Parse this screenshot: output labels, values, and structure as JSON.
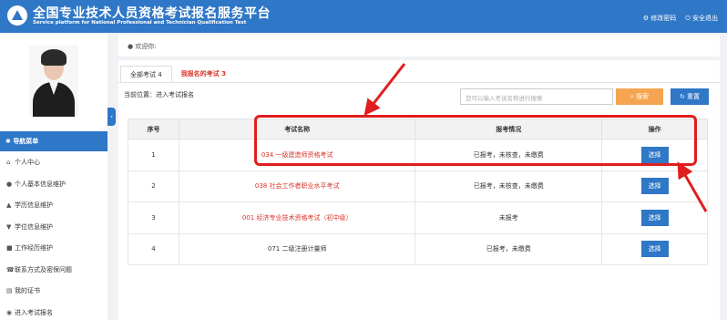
{
  "header": {
    "title": "全国专业技术人员资格考试报名服务平台",
    "subtitle": "Service platform for National Professional and Technician Qualification Test",
    "change_password": "修改密码",
    "logout": "安全退出"
  },
  "user": {
    "welcome": "欢迎你:"
  },
  "sidebar": {
    "nav_head": "导航菜单",
    "items": [
      {
        "label": "个人中心",
        "icon": "home-icon"
      },
      {
        "label": "个人基本信息维护",
        "icon": "user-icon"
      },
      {
        "label": "学历信息维护",
        "icon": "graduation-cap-icon"
      },
      {
        "label": "学位信息维护",
        "icon": "degree-icon"
      },
      {
        "label": "工作经历维护",
        "icon": "briefcase-icon"
      },
      {
        "label": "联系方式及密保问题",
        "icon": "phone-icon"
      },
      {
        "label": "我的证书",
        "icon": "certificate-icon"
      },
      {
        "label": "进入考试报名",
        "icon": "enter-icon"
      }
    ]
  },
  "tabs": {
    "all": "全部考试 4",
    "mine": "我报名的考试 3"
  },
  "location": "当前位置：进入考试报名",
  "search": {
    "placeholder": "您可以输入考试名称进行搜索",
    "search_label": "搜索",
    "reset_label": "重置"
  },
  "table": {
    "headers": [
      "序号",
      "考试名称",
      "报考情况",
      "操作"
    ],
    "rows": [
      {
        "idx": "1",
        "name": "034 一级建造师资格考试",
        "status": "已报考，未核查，未缴费",
        "action": "选择"
      },
      {
        "idx": "2",
        "name": "038 社会工作者职业水平考试",
        "status": "已报考，未核查，未缴费",
        "action": "选择"
      },
      {
        "idx": "3",
        "name": "001 经济专业技术资格考试（初中级）",
        "status": "未报考",
        "action": "选择"
      },
      {
        "idx": "4",
        "name": "071 二级注册计量师",
        "status": "已报考，未缴费",
        "action": "选择"
      }
    ]
  },
  "colors": {
    "brand_blue": "#2f77c7",
    "accent_red": "#d9342b",
    "search_orange": "#f5a551"
  }
}
